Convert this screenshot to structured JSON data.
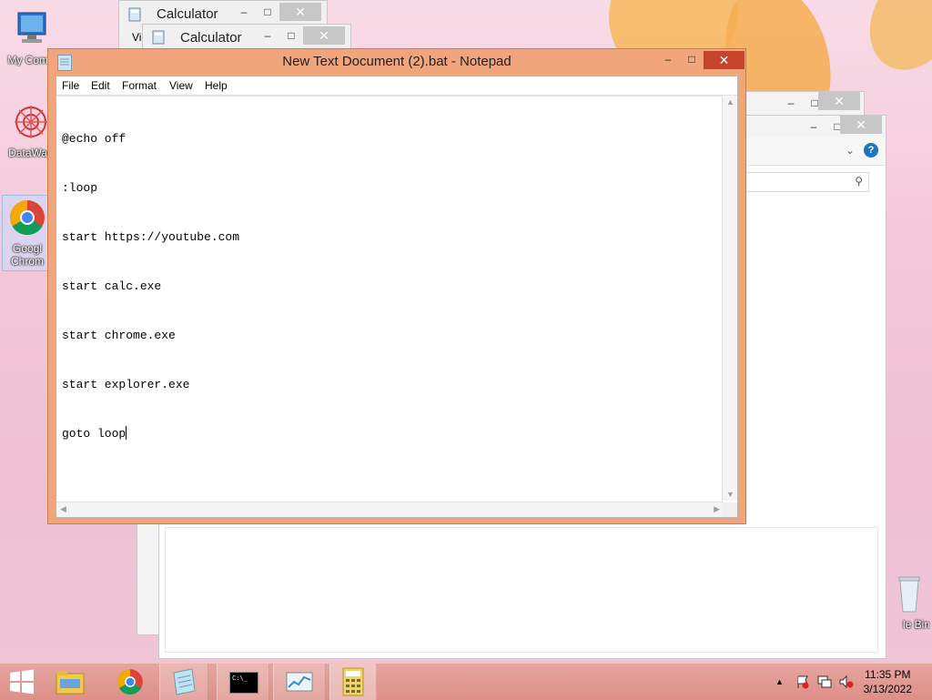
{
  "desktop": {
    "icons": [
      {
        "label": "My Comp",
        "icon": "computer-icon"
      },
      {
        "label": "DataWag",
        "icon": "datawag-icon"
      },
      {
        "label": "Googl\nChrom",
        "icon": "chrome-icon"
      },
      {
        "label": "le Bin",
        "icon": "recycle-bin-icon"
      }
    ]
  },
  "calculator_windows": [
    {
      "title": "Calculator",
      "menu_fragment": "Vi"
    },
    {
      "title": "Calculator"
    }
  ],
  "window_controls": {
    "minimize": "–",
    "maximize": "□",
    "close": "✕"
  },
  "notepad": {
    "title": "New Text Document (2).bat - Notepad",
    "menu": [
      "File",
      "Edit",
      "Format",
      "View",
      "Help"
    ],
    "lines": [
      "@echo off",
      ":loop",
      "start https://youtube.com",
      "start calc.exe",
      "start chrome.exe",
      "start explorer.exe",
      "goto loop"
    ]
  },
  "explorer": {
    "help_label": "?"
  },
  "taskbar": {
    "start_icon": "windows-start-icon",
    "apps": [
      "file-explorer-icon",
      "chrome-icon",
      "notepad-icon",
      "cmd-icon",
      "task-manager-icon",
      "calculator-icon"
    ],
    "cmd_glyph": "C:\\_",
    "tray_arrow": "▲",
    "time": "11:35 PM",
    "date": "3/13/2022"
  },
  "colors": {
    "notepad_frame": "#f0a57c",
    "close_red": "#c7432b",
    "taskbar": "#dd8f88"
  }
}
